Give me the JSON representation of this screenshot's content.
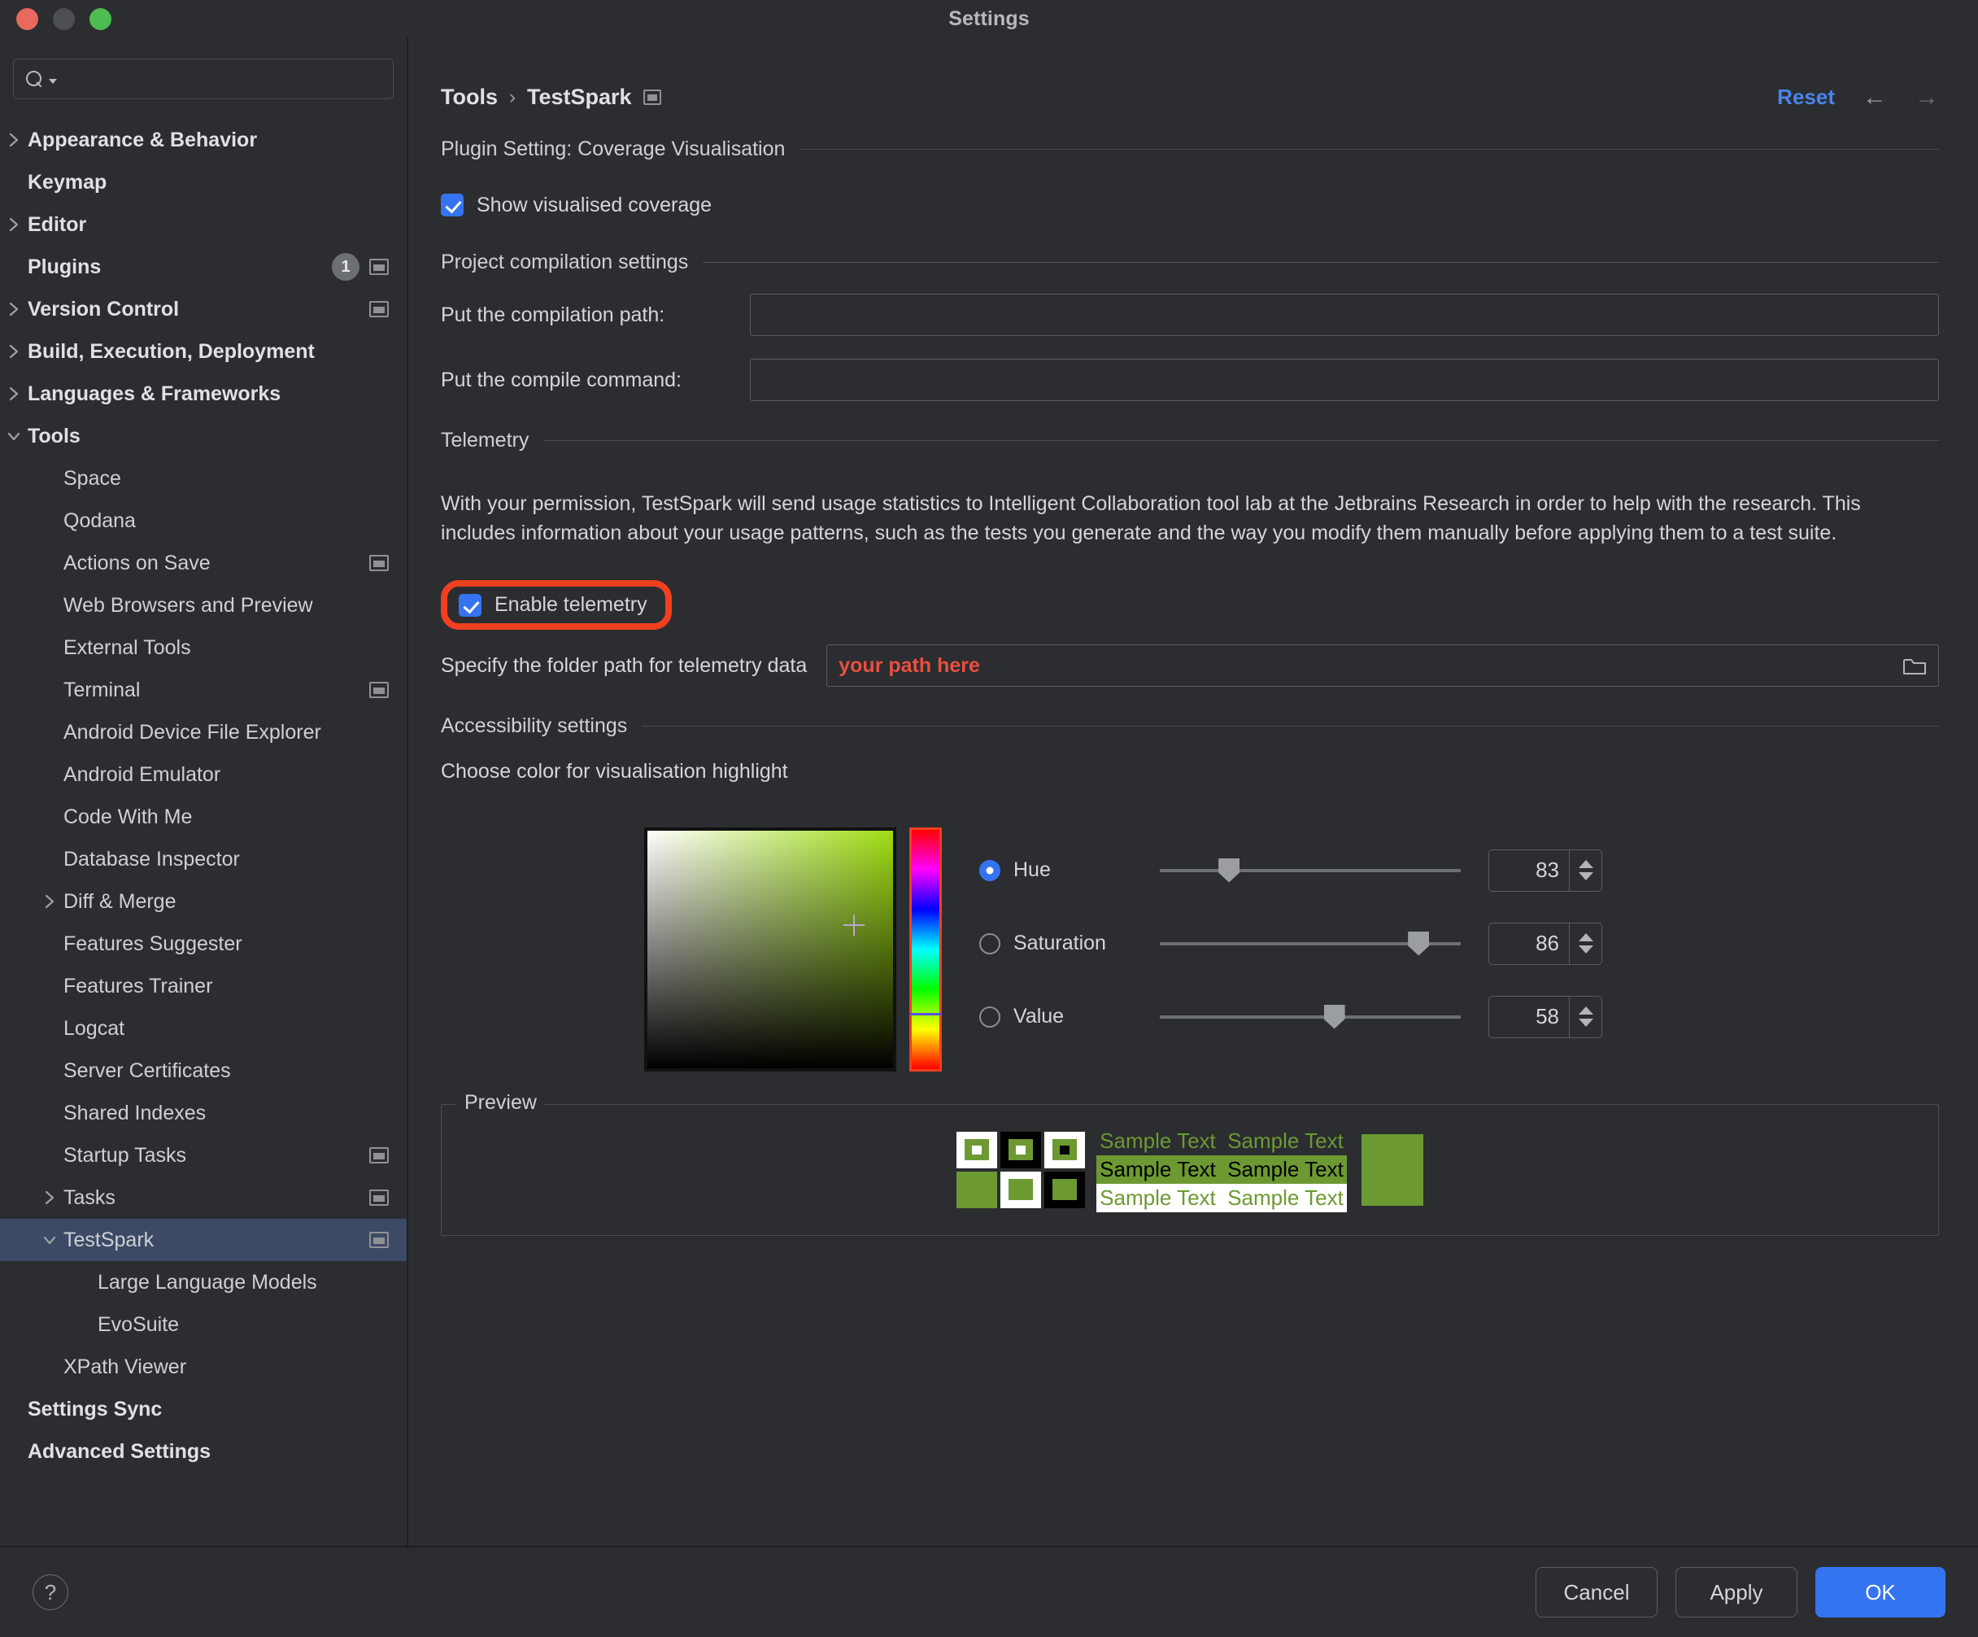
{
  "window": {
    "title": "Settings",
    "traffic_lights": [
      "close-button",
      "minimize-button",
      "zoom-button"
    ]
  },
  "search": {
    "value": "",
    "placeholder": ""
  },
  "sidebar": {
    "items": [
      {
        "label": "Appearance & Behavior",
        "arrow": "right",
        "bold": true,
        "indent": 0
      },
      {
        "label": "Keymap",
        "arrow": "none",
        "bold": true,
        "indent": 0
      },
      {
        "label": "Editor",
        "arrow": "right",
        "bold": true,
        "indent": 0
      },
      {
        "label": "Plugins",
        "arrow": "none",
        "bold": true,
        "indent": 0,
        "badge": "1",
        "proj_icon": true
      },
      {
        "label": "Version Control",
        "arrow": "right",
        "bold": true,
        "indent": 0,
        "proj_icon": true
      },
      {
        "label": "Build, Execution, Deployment",
        "arrow": "right",
        "bold": true,
        "indent": 0
      },
      {
        "label": "Languages & Frameworks",
        "arrow": "right",
        "bold": true,
        "indent": 0
      },
      {
        "label": "Tools",
        "arrow": "down",
        "bold": true,
        "indent": 0
      },
      {
        "label": "Space",
        "arrow": "none",
        "bold": false,
        "indent": 1
      },
      {
        "label": "Qodana",
        "arrow": "none",
        "bold": false,
        "indent": 1
      },
      {
        "label": "Actions on Save",
        "arrow": "none",
        "bold": false,
        "indent": 1,
        "proj_icon": true
      },
      {
        "label": "Web Browsers and Preview",
        "arrow": "none",
        "bold": false,
        "indent": 1
      },
      {
        "label": "External Tools",
        "arrow": "none",
        "bold": false,
        "indent": 1
      },
      {
        "label": "Terminal",
        "arrow": "none",
        "bold": false,
        "indent": 1,
        "proj_icon": true
      },
      {
        "label": "Android Device File Explorer",
        "arrow": "none",
        "bold": false,
        "indent": 1
      },
      {
        "label": "Android Emulator",
        "arrow": "none",
        "bold": false,
        "indent": 1
      },
      {
        "label": "Code With Me",
        "arrow": "none",
        "bold": false,
        "indent": 1
      },
      {
        "label": "Database Inspector",
        "arrow": "none",
        "bold": false,
        "indent": 1
      },
      {
        "label": "Diff & Merge",
        "arrow": "right",
        "bold": false,
        "indent": 1
      },
      {
        "label": "Features Suggester",
        "arrow": "none",
        "bold": false,
        "indent": 1
      },
      {
        "label": "Features Trainer",
        "arrow": "none",
        "bold": false,
        "indent": 1
      },
      {
        "label": "Logcat",
        "arrow": "none",
        "bold": false,
        "indent": 1
      },
      {
        "label": "Server Certificates",
        "arrow": "none",
        "bold": false,
        "indent": 1
      },
      {
        "label": "Shared Indexes",
        "arrow": "none",
        "bold": false,
        "indent": 1
      },
      {
        "label": "Startup Tasks",
        "arrow": "none",
        "bold": false,
        "indent": 1,
        "proj_icon": true
      },
      {
        "label": "Tasks",
        "arrow": "right",
        "bold": false,
        "indent": 1,
        "proj_icon": true
      },
      {
        "label": "TestSpark",
        "arrow": "down",
        "bold": false,
        "indent": 1,
        "proj_icon": true,
        "selected": true
      },
      {
        "label": "Large Language Models",
        "arrow": "none",
        "bold": false,
        "indent": 2
      },
      {
        "label": "EvoSuite",
        "arrow": "none",
        "bold": false,
        "indent": 2
      },
      {
        "label": "XPath Viewer",
        "arrow": "none",
        "bold": false,
        "indent": 1
      },
      {
        "label": "Settings Sync",
        "arrow": "none",
        "bold": true,
        "indent": 0
      },
      {
        "label": "Advanced Settings",
        "arrow": "none",
        "bold": true,
        "indent": 0
      }
    ]
  },
  "header": {
    "breadcrumb_root": "Tools",
    "breadcrumb_sep": "›",
    "breadcrumb_leaf": "TestSpark",
    "reset_label": "Reset",
    "back_arrow": "←",
    "forward_arrow": "→"
  },
  "main": {
    "coverage_section": {
      "title": "Plugin Setting: Coverage Visualisation",
      "checkbox_label": "Show visualised coverage",
      "checked": true
    },
    "compilation_section": {
      "title": "Project compilation settings",
      "path_label": "Put the compilation path:",
      "path_value": "",
      "command_label": "Put the compile command:",
      "command_value": ""
    },
    "telemetry_section": {
      "title": "Telemetry",
      "description": "With your permission, TestSpark will send usage statistics to Intelligent Collaboration tool lab at the Jetbrains Research in order to help with the research. This includes information about your usage patterns, such as the tests you generate and the way you modify them manually before applying them to a test suite.",
      "checkbox_label": "Enable telemetry",
      "checked": true,
      "highlight_color": "#f0401f",
      "folder_label": "Specify the folder path for telemetry data",
      "folder_value": "your path here",
      "folder_value_color": "#e8503f"
    },
    "accessibility_section": {
      "title": "Accessibility settings",
      "choose_color_label": "Choose color for visualisation highlight"
    },
    "color_picker": {
      "selected_color": "#6d9933",
      "hsv": [
        {
          "name": "Hue",
          "value": "83",
          "selected": true,
          "percent": 23
        },
        {
          "name": "Saturation",
          "value": "86",
          "selected": false,
          "percent": 86
        },
        {
          "name": "Value",
          "value": "58",
          "selected": false,
          "percent": 58
        }
      ]
    },
    "preview": {
      "legend": "Preview",
      "sample_text": "Sample Text",
      "green": "#6d9933",
      "white": "#ffffff",
      "black": "#000000"
    }
  },
  "footer": {
    "help_glyph": "?",
    "cancel_label": "Cancel",
    "apply_label": "Apply",
    "ok_label": "OK"
  }
}
